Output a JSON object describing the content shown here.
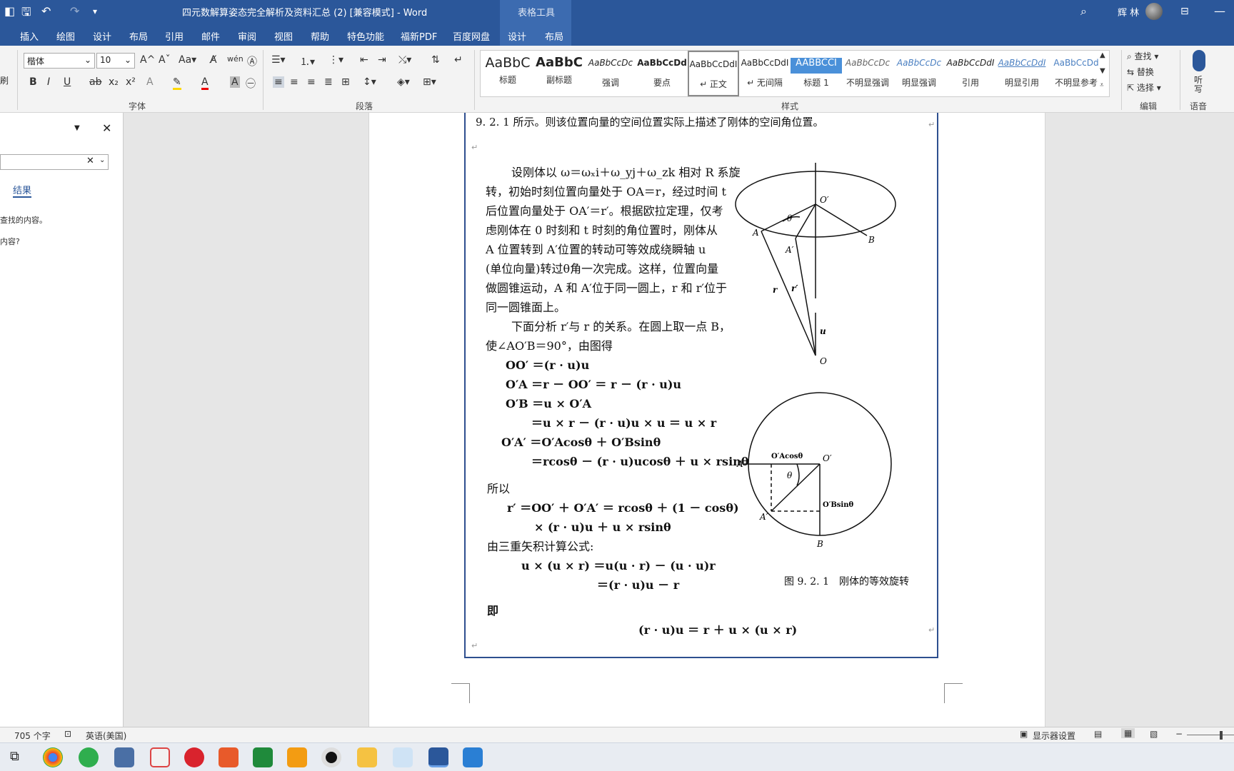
{
  "window": {
    "title": "四元数解算姿态完全解析及资料汇总 (2)  [兼容模式]  -  Word",
    "context_tab_label": "表格工具",
    "user_name": "辉 林"
  },
  "tabs": [
    "插入",
    "绘图",
    "设计",
    "布局",
    "引用",
    "邮件",
    "审阅",
    "视图",
    "帮助",
    "特色功能",
    "福新PDF",
    "百度网盘",
    "设计",
    "布局"
  ],
  "ribbon": {
    "font_name": "楷体",
    "font_size": "10",
    "group_font": "字体",
    "group_paragraph": "段落",
    "group_styles": "样式",
    "group_edit": "编辑",
    "group_voice": "语音",
    "left_cut": "刷",
    "find": "查找",
    "replace": "替换",
    "select": "选择",
    "dictate": "听写",
    "styles": [
      {
        "preview": "AaBbC",
        "name": "标题"
      },
      {
        "preview": "AaBbC",
        "name": "副标题"
      },
      {
        "preview": "AaBbCcDc",
        "name": "强调"
      },
      {
        "preview": "AaBbCcDd",
        "name": "要点"
      },
      {
        "preview": "AaBbCcDdI",
        "name": "↵ 正文"
      },
      {
        "preview": "AaBbCcDdI",
        "name": "↵ 无间隔"
      },
      {
        "preview": "AABBCCI",
        "name": "标题 1"
      },
      {
        "preview": "AaBbCcDc",
        "name": "不明显强调"
      },
      {
        "preview": "AaBbCcDc",
        "name": "明显强调"
      },
      {
        "preview": "AaBbCcDdI",
        "name": "引用"
      },
      {
        "preview": "AaBbCcDdI",
        "name": "明显引用"
      },
      {
        "preview": "AaBbCcDd",
        "name": "不明显参考"
      }
    ]
  },
  "nav_pane": {
    "results_tab": "结果",
    "msg1": "查找的内容。",
    "msg2": "内容?"
  },
  "document": {
    "top_line": "9. 2. 1 所示。则该位置向量的空间位置实际上描述了刚体的空间角位置。",
    "para": [
      "设刚体以 ω＝ωₓi＋ω_yj＋ω_zk 相对 R 系旋",
      "转，初始时刻位置向量处于 OA＝r，经过时间 t",
      "后位置向量处于 OA′＝r′。根据欧拉定理，仅考",
      "虑刚体在 0 时刻和 t 时刻的角位置时，刚体从",
      "A 位置转到 A′位置的转动可等效成绕瞬轴 u",
      "(单位向量)转过θ角一次完成。这样，位置向量",
      "做圆锥运动，A 和 A′位于同一圆上，r 和 r′位于",
      "同一圆锥面上。",
      "下面分析 r′与 r 的关系。在圆上取一点 B，",
      "使∠AO′B＝90°，由图得"
    ],
    "eqs": [
      "OO′ ＝(r · u)u",
      "O′A ＝r － OO′ ＝ r － (r · u)u",
      "O′B ＝u × O′A",
      "＝u × r － (r · u)u × u ＝ u × r",
      "O′A′ ＝O′Acosθ ＋ O′Bsinθ",
      "＝rcosθ － (r · u)ucosθ ＋ u × rsinθ"
    ],
    "suoyi": "所以",
    "eq2": [
      "r′ ＝OO′ ＋ O′A′ ＝ rcosθ ＋ (1 － cosθ)",
      "× (r · u)u ＋ u × rsinθ"
    ],
    "triple": "由三重矢积计算公式:",
    "eq3": [
      "u × (u × r) ＝u(u · r) － (u · u)r",
      "＝(r · u)u － r"
    ],
    "ji": "即",
    "final_eq": "(r · u)u ＝ r ＋ u × (u × r)",
    "caption": "图 9. 2. 1　刚体的等效旋转",
    "fig_labels": {
      "O_prime": "O′",
      "A": "A",
      "B": "B",
      "A_prime": "A′",
      "theta": "θ",
      "r": "r",
      "r_prime": "r′",
      "u": "u",
      "O": "O",
      "OpAcos": "O′Acosθ",
      "OpBsin": "O′Bsinθ"
    }
  },
  "status": {
    "word_count": "705 个字",
    "language": "英语(美国)",
    "display_settings": "显示器设置"
  }
}
